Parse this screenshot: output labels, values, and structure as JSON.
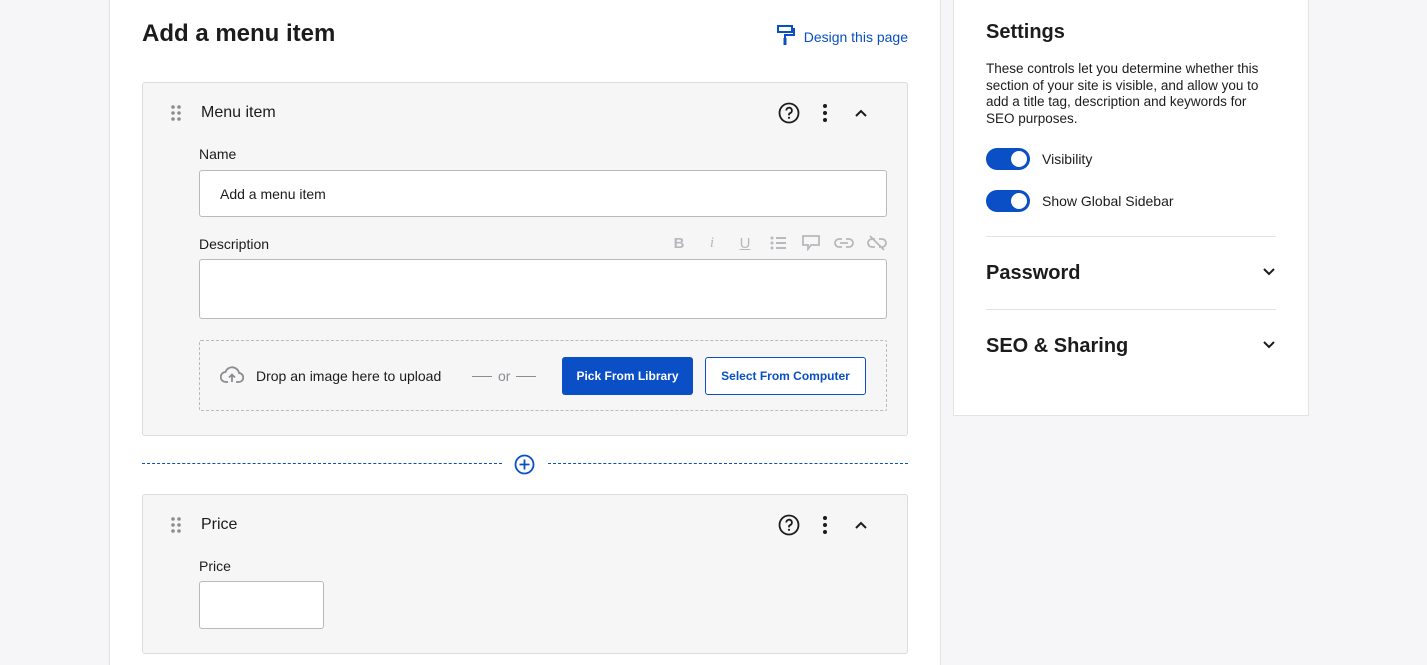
{
  "header": {
    "title": "Add a menu item",
    "design_link": "Design this page",
    "design_icon": "paint-roller-icon"
  },
  "menu_card": {
    "title": "Menu item",
    "name_label": "Name",
    "name_value": "Add a menu item",
    "description_label": "Description",
    "toolbar": [
      "bold-icon",
      "italic-icon",
      "underline-icon",
      "bullet-list-icon",
      "callout-icon",
      "link-icon",
      "unlink-icon"
    ],
    "upload_text": "Drop an image here to upload",
    "upload_or": "or",
    "pick_library_label": "Pick From Library",
    "select_computer_label": "Select From Computer"
  },
  "price_card": {
    "title": "Price",
    "price_label": "Price",
    "price_value": ""
  },
  "settings": {
    "title": "Settings",
    "description": "These controls let you determine whether this section of your site is visible, and allow you to add a title tag, description and keywords for SEO purposes.",
    "toggles": [
      {
        "label": "Visibility",
        "on": true
      },
      {
        "label": "Show Global Sidebar",
        "on": true
      }
    ],
    "sections": [
      {
        "title": "Password"
      },
      {
        "title": "SEO & Sharing"
      }
    ]
  },
  "colors": {
    "accent": "#0a4fc5",
    "background": "#f6f6f8",
    "card": "#f6f6f7"
  }
}
